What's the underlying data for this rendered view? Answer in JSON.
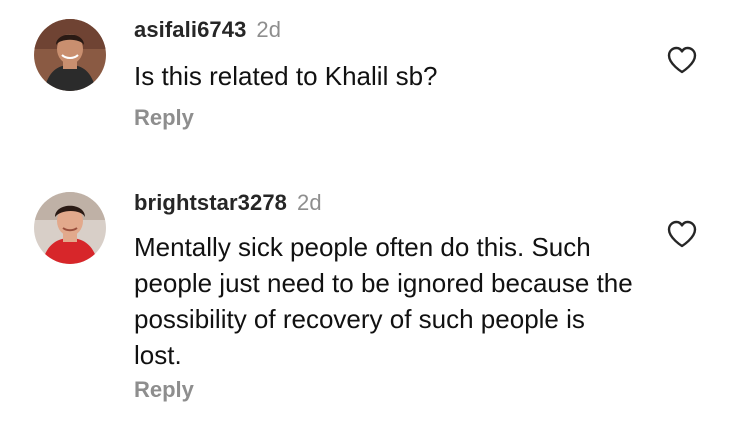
{
  "comments": [
    {
      "username": "asifali6743",
      "time": "2d",
      "text": "Is this related to Khalil sb?",
      "reply_label": "Reply",
      "avatar_colors": {
        "bg": "#8a5a43",
        "skin": "#c98f6f",
        "hair": "#2a1a14",
        "shirt": "#2b2b2b"
      }
    },
    {
      "username": "brightstar3278",
      "time": "2d",
      "text": "Mentally sick people often do this. Such people just need to be ignored because the possibility of recovery of such people is lost.",
      "reply_label": "Reply",
      "avatar_colors": {
        "bg": "#d8cfc8",
        "skin": "#e2a98c",
        "hair": "#2a1a14",
        "shirt": "#d7262a"
      }
    }
  ],
  "icons": {
    "like": "heart-outline-icon"
  },
  "colors": {
    "text": "#111111",
    "username": "#262626",
    "meta": "#8e8e8e"
  }
}
